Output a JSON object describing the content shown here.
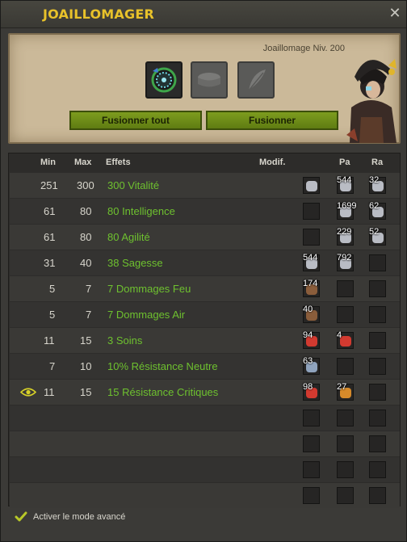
{
  "window": {
    "title": "JOAILLOMAGER",
    "close_icon": "close-icon"
  },
  "workshop": {
    "level_text": "Joaillomage Niv. 200",
    "slots": [
      "rune-slot",
      "smithmagic-slot-1",
      "smithmagic-slot-2"
    ],
    "fuse_all_label": "Fusionner tout",
    "fuse_label": "Fusionner"
  },
  "table": {
    "headers": {
      "min": "Min",
      "max": "Max",
      "effects": "Effets",
      "modif": "Modif.",
      "pa": "Pa",
      "ra": "Ra"
    },
    "rows": [
      {
        "min": "251",
        "max": "300",
        "effect": "300 Vitalité",
        "modif": "",
        "pa": "544",
        "ra": "32",
        "modif_rune": "silver",
        "pa_rune": "silver",
        "ra_rune": "silver"
      },
      {
        "min": "61",
        "max": "80",
        "effect": "80 Intelligence",
        "modif": "",
        "pa": "1699",
        "ra": "62",
        "modif_rune": "none",
        "pa_rune": "silver",
        "ra_rune": "silver"
      },
      {
        "min": "61",
        "max": "80",
        "effect": "80 Agilité",
        "modif": "",
        "pa": "229",
        "ra": "52",
        "modif_rune": "none",
        "pa_rune": "silver",
        "ra_rune": "silver"
      },
      {
        "min": "31",
        "max": "40",
        "effect": "38 Sagesse",
        "modif": "544",
        "pa": "792",
        "ra": "",
        "modif_rune": "silver",
        "pa_rune": "silver",
        "ra_rune": "none"
      },
      {
        "min": "5",
        "max": "7",
        "effect": "7 Dommages Feu",
        "modif": "174",
        "pa": "",
        "ra": "",
        "modif_rune": "brown",
        "pa_rune": "none",
        "ra_rune": "none"
      },
      {
        "min": "5",
        "max": "7",
        "effect": "7 Dommages Air",
        "modif": "40",
        "pa": "",
        "ra": "",
        "modif_rune": "brown",
        "pa_rune": "none",
        "ra_rune": "none"
      },
      {
        "min": "11",
        "max": "15",
        "effect": "3 Soins",
        "modif": "94",
        "pa": "4",
        "ra": "",
        "modif_rune": "red",
        "pa_rune": "red",
        "ra_rune": "none"
      },
      {
        "min": "7",
        "max": "10",
        "effect": "10% Résistance Neutre",
        "modif": "63",
        "pa": "",
        "ra": "",
        "modif_rune": "silver",
        "pa_rune": "none",
        "ra_rune": "none"
      },
      {
        "min": "11",
        "max": "15",
        "effect": "15 Résistance Critiques",
        "modif": "98",
        "pa": "27",
        "ra": "",
        "modif_rune": "red",
        "pa_rune": "orange",
        "ra_rune": "none",
        "eye_icon": "eye-icon"
      }
    ],
    "empty_rows": 4
  },
  "footer": {
    "check_icon": "checkmark-icon",
    "advanced_mode_label": "Activer le mode avancé"
  },
  "colors": {
    "title": "#e8c22a",
    "effect_text": "#6ec12f",
    "button": "#6f8e18"
  }
}
